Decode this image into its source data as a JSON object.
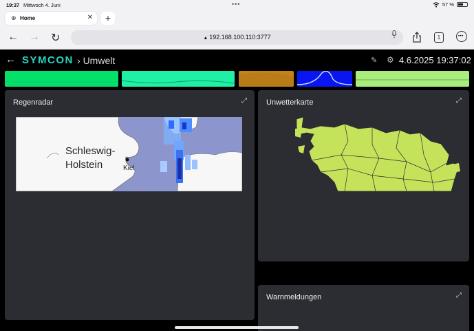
{
  "status_bar": {
    "time": "19:37",
    "date": "Mittwoch 4. Juni",
    "battery": "57 %",
    "battery_level": 0.57
  },
  "browser": {
    "tab": {
      "title": "Home",
      "close": "✕"
    },
    "new_tab": "+",
    "url": "192.168.100.110:3777",
    "tab_count": "1"
  },
  "app": {
    "logo": "SYMCON",
    "breadcrumb": "Umwelt",
    "separator": "›",
    "datetime": "4.6.2025 19:37:02"
  },
  "tiles": {
    "colors": [
      "#05e06a",
      "#1ff0a6",
      "#c48312",
      "#0a16f2",
      "#a9ee7c"
    ]
  },
  "cards": {
    "regenradar": {
      "title": "Regenradar",
      "map_label_line1": "Schleswig-",
      "map_label_line2": "Holstein",
      "city": "Kiel"
    },
    "unwetterkarte": {
      "title": "Unwetterkarte"
    },
    "warnmeldungen": {
      "title": "Warnmeldungen"
    }
  },
  "colors": {
    "accent": "#2ad6c2",
    "card_bg": "#2b2d33",
    "map_fill": "#c5e35a",
    "water": "#8c96cc"
  }
}
